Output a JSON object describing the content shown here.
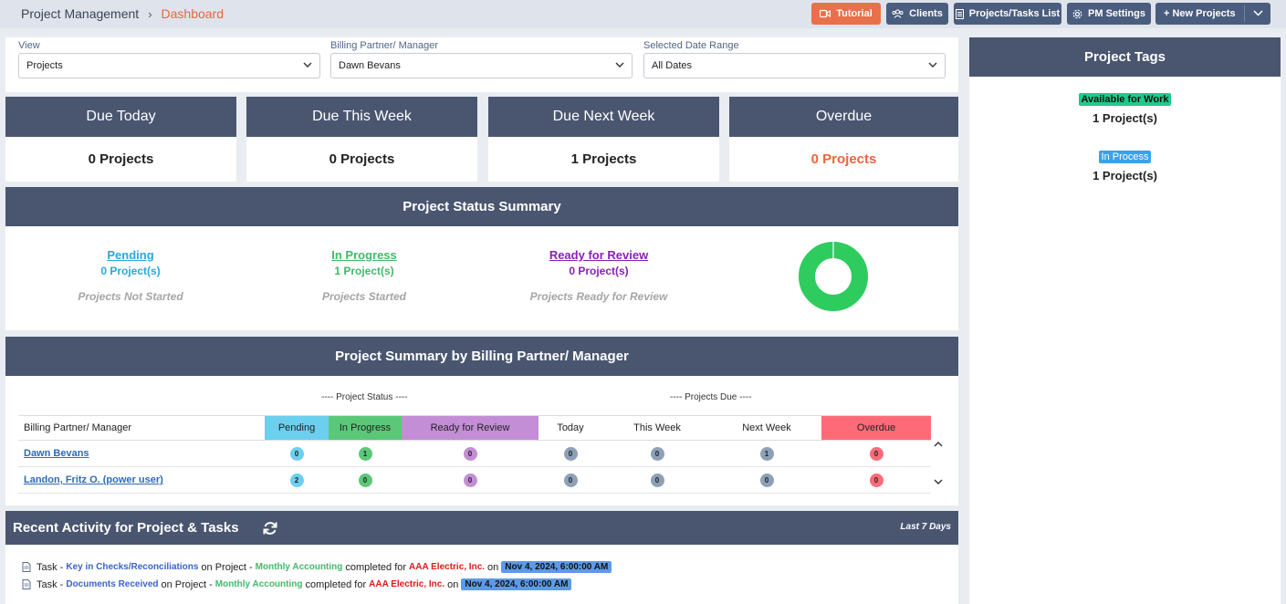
{
  "breadcrumb": {
    "root": "Project Management",
    "separator": "›",
    "current": "Dashboard"
  },
  "toolbar": {
    "tutorial": "Tutorial",
    "clients": "Clients",
    "projects_tasks_list": "Projects/Tasks List",
    "pm_settings": "PM Settings",
    "new_projects": "+ New Projects"
  },
  "filters": {
    "view": {
      "label": "View",
      "value": "Projects"
    },
    "billing": {
      "label": "Billing Partner/ Manager",
      "value": "Dawn Bevans"
    },
    "date_range": {
      "label": "Selected Date Range",
      "value": "All Dates"
    }
  },
  "cards": [
    {
      "title": "Due Today",
      "value": "0 Projects"
    },
    {
      "title": "Due This Week",
      "value": "0 Projects"
    },
    {
      "title": "Due Next Week",
      "value": "1 Projects"
    },
    {
      "title": "Overdue",
      "value": "0 Projects"
    }
  ],
  "status_summary": {
    "title": "Project Status Summary",
    "pending": {
      "label": "Pending",
      "count": "0 Project(s)",
      "sub": "Projects Not Started",
      "color": "#26a8dd"
    },
    "in_progress": {
      "label": "In Progress",
      "count": "1 Project(s)",
      "sub": "Projects Started",
      "color": "#43b86a"
    },
    "ready": {
      "label": "Ready for Review",
      "count": "0 Project(s)",
      "sub": "Projects Ready for Review",
      "color": "#8a1fb5"
    },
    "donut_color": "#2ecc5f"
  },
  "billing_summary": {
    "title": "Project Summary by Billing Partner/ Manager",
    "group_status": "---- Project Status ----",
    "group_due": "---- Projects Due ----",
    "headers": [
      "Billing Partner/ Manager",
      "Pending",
      "In Progress",
      "Ready for Review",
      "Today",
      "This Week",
      "Next Week",
      "Overdue"
    ],
    "rows": [
      {
        "name": "Dawn Bevans",
        "values": [
          "0",
          "1",
          "0",
          "0",
          "0",
          "1",
          "0"
        ]
      },
      {
        "name": "Landon, Fritz O. (power user)",
        "values": [
          "2",
          "0",
          "0",
          "0",
          "0",
          "0",
          "0"
        ]
      }
    ]
  },
  "activity": {
    "title": "Recent Activity for Project & Tasks",
    "period": "Last 7 Days",
    "items": [
      {
        "prefix": "Task -",
        "task": "Key in Checks/Reconciliations",
        "mid": "on Project -",
        "project": "Monthly Accounting",
        "verb": "completed for",
        "client": "AAA Electric, Inc.",
        "on": "on",
        "date": "Nov 4, 2024, 6:00:00 AM"
      },
      {
        "prefix": "Task -",
        "task": "Documents Received",
        "mid": "on Project -",
        "project": "Monthly Accounting",
        "verb": "completed for",
        "client": "AAA Electric, Inc.",
        "on": "on",
        "date": "Nov 4, 2024, 6:00:00 AM"
      }
    ]
  },
  "tags": {
    "title": "Project Tags",
    "items": [
      {
        "name": "Available for Work",
        "count": "1 Project(s)"
      },
      {
        "name": "In Process",
        "count": "1 Project(s)"
      }
    ]
  }
}
